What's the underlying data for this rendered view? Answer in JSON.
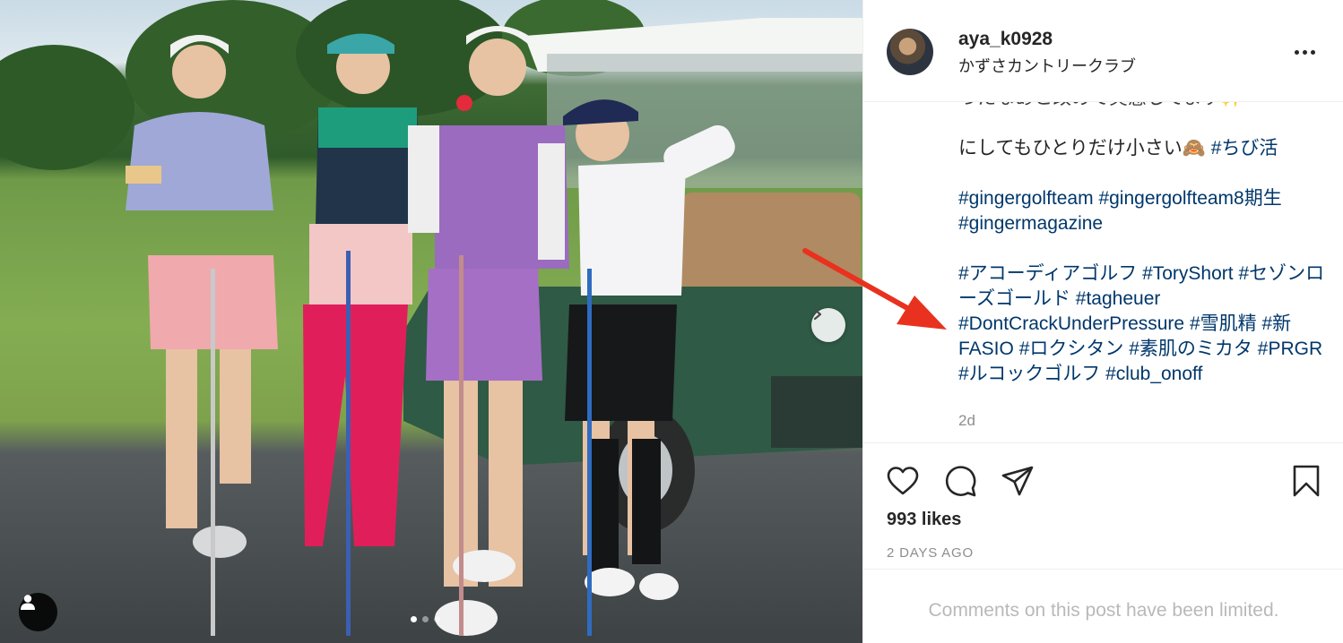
{
  "post": {
    "username": "aya_k0928",
    "location": "かずさカントリークラブ",
    "caption": {
      "cut_line": "ったなあと改めて実感してます✨",
      "line1_text": "にしてもひとりだけ小さい🙈",
      "line1_tag": "#ちび活",
      "tags_a": [
        "#gingergolfteam",
        "#gingergolfteam8期生",
        "#gingermagazine"
      ],
      "tags_b": [
        "#アコーディアゴルフ",
        "#ToryShort",
        "#セゾンローズゴールド",
        "#tagheuer",
        "#DontCrackUnderPressure",
        "#雪肌精",
        "#新FASIO",
        "#ロクシタン",
        "#素肌のミカタ",
        "#PRGR",
        "#ルコックゴルフ",
        "#club_onoff"
      ]
    },
    "time_ago": "2d",
    "likes": "993 likes",
    "date": "2 DAYS AGO",
    "comments_notice": "Comments on this post have been limited."
  },
  "photo": {
    "carousel_total": 3,
    "carousel_active": 1
  },
  "icons": [
    "heart-icon",
    "comment-icon",
    "share-icon",
    "bookmark-icon",
    "more-options-icon",
    "chevron-right-icon",
    "user-tag-icon"
  ],
  "colors": {
    "hashtag": "#00376b",
    "arrow": "#e8321f",
    "muted": "#8e8e8e"
  }
}
